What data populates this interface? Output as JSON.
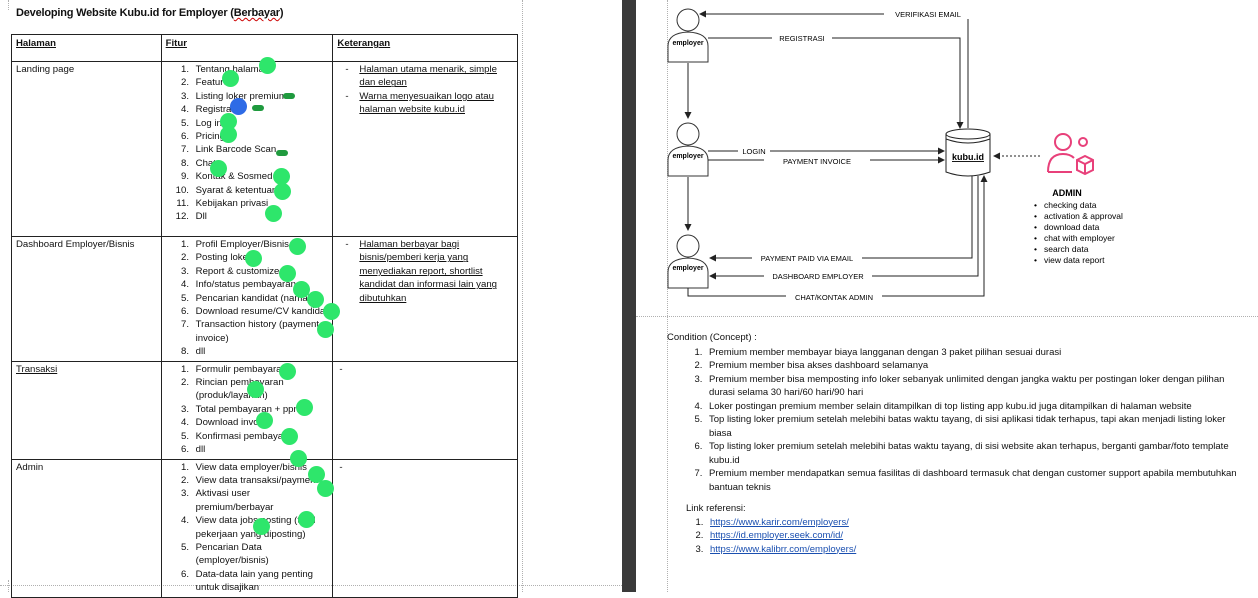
{
  "left": {
    "title_plain": "Developing Website Kubu.id for Employer (",
    "title_underlined": "Berbayar",
    "title_close": ")",
    "headers": [
      "Halaman",
      "Fitur",
      "Keterangan"
    ],
    "rows": [
      {
        "page": "Landing page",
        "features": [
          "Tentang halaman",
          "Features",
          "Listing loker premium",
          "Registrasi",
          "Log in",
          "Pricing",
          "Link Barcode Scan",
          "Chat",
          "Kontak & Sosmed",
          "Syarat & ketentuan",
          "Kebijakan privasi",
          "Dll"
        ],
        "notes": [
          "Halaman utama menarik, simple dan elegan",
          "Warna menyesuaikan logo atau halaman website kubu.id"
        ]
      },
      {
        "page": "Dashboard Employer/Bisnis",
        "features": [
          "Profil Employer/Bisnis",
          "Posting loker",
          "Report & customize",
          "Info/status pembayaran",
          "Pencarian kandidat (nama)",
          "Download resume/CV kandidat",
          "Transaction history (payment, invoice)",
          "dll"
        ],
        "notes": [
          "Halaman berbayar bagi bisnis/pemberi kerja yang menyediakan report, shortlist kandidat dan informasi lain yang dibutuhkan"
        ]
      },
      {
        "page": "Transaksi",
        "features": [
          "Formulir pembayaran",
          "Rincian pembayaran (produk/layanan)",
          "Total pembayaran + ppn",
          "Download invoice",
          "Konfirmasi pembayaran",
          "dll"
        ],
        "notes_dash": "-"
      },
      {
        "page": "Admin",
        "features": [
          "View data employer/bisnis",
          "View data transaksi/payment",
          "Aktivasi user premium/berbayar",
          "View data jobs posting (total pekerjaan yang diposting)",
          "Pencarian Data (employer/bisnis)",
          "Data-data lain yang penting untuk disajikan"
        ],
        "notes_dash": "-"
      }
    ]
  },
  "diagram": {
    "actor": "employer",
    "database": "kubu.id",
    "arrows": {
      "verifikasi": "VERIFIKASI EMAIL",
      "registrasi": "REGISTRASI",
      "login": "LOGIN",
      "payment_invoice": "PAYMENT INVOICE",
      "payment_paid": "PAYMENT PAID VIA EMAIL",
      "dashboard": "DASHBOARD EMPLOYER",
      "chat": "CHAT/KONTAK ADMIN"
    },
    "admin": {
      "title": "ADMIN",
      "items": [
        "checking data",
        "activation & approval",
        "download data",
        "chat with employer",
        "search data",
        "view data report"
      ]
    },
    "colors": {
      "admin_icon": "#e8407a"
    }
  },
  "condition": {
    "heading": "Condition (Concept) :",
    "items": [
      "Premium member membayar biaya langganan dengan 3 paket pilihan sesuai durasi",
      "Premium member bisa akses dashboard selamanya",
      "Premium member bisa memposting info loker sebanyak unlimited dengan jangka waktu per postingan loker dengan pilihan durasi selama 30 hari/60 hari/90 hari",
      "Loker postingan premium member selain ditampilkan di top listing app kubu.id juga ditampilkan di halaman website",
      "Top listing loker premium setelah melebihi batas waktu tayang, di sisi aplikasi tidak terhapus, tapi akan menjadi listing loker biasa",
      "Top listing loker premium setelah melebihi batas waktu tayang, di sisi website akan terhapus, berganti gambar/foto template kubu.id",
      "Premium member mendapatkan semua fasilitas di dashboard termasuk chat dengan customer support apabila membutuhkan bantuan teknis"
    ],
    "links_heading": "Link referensi:",
    "links": [
      "https://www.karir.com/employers/",
      "https://id.employer.seek.com/id/",
      "https://www.kalibrr.com/employers/"
    ]
  }
}
